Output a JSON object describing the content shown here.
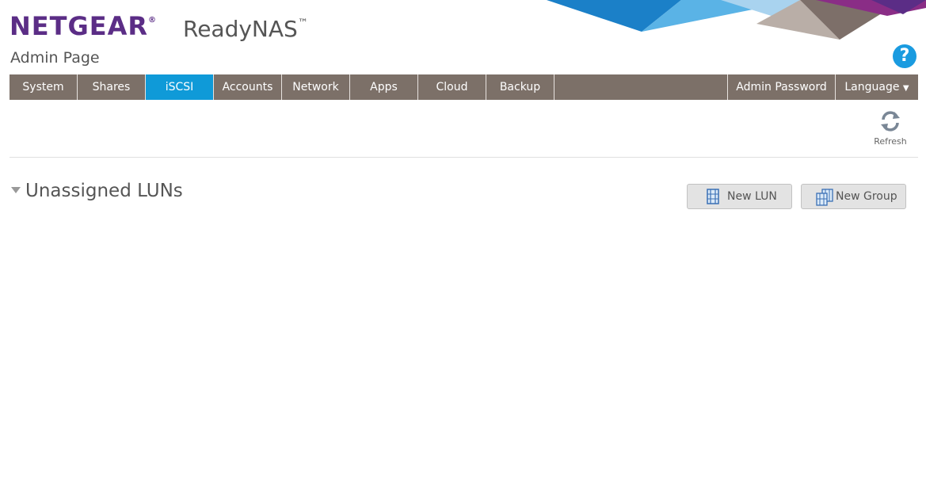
{
  "brand": {
    "logo": "NETGEAR",
    "product": "ReadyNAS",
    "product_mark": "™"
  },
  "header": {
    "subtitle": "Admin Page",
    "help_glyph": "?"
  },
  "nav": {
    "tabs": [
      {
        "label": "System"
      },
      {
        "label": "Shares"
      },
      {
        "label": "iSCSI",
        "active": true
      },
      {
        "label": "Accounts"
      },
      {
        "label": "Network"
      },
      {
        "label": "Apps"
      },
      {
        "label": "Cloud"
      },
      {
        "label": "Backup"
      }
    ],
    "admin_password": "Admin Password",
    "language": "Language"
  },
  "toolbar": {
    "refresh_label": "Refresh"
  },
  "section": {
    "title": "Unassigned LUNs",
    "new_lun_label": "New LUN",
    "new_group_label": "New Group"
  },
  "colors": {
    "brand_purple": "#5b2d86",
    "nav_bg": "#7c7068",
    "active_tab": "#0f9ad8",
    "help_blue": "#1a9be0"
  }
}
